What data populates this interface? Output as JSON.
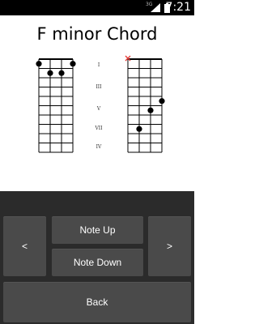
{
  "status_bar": {
    "network": "3G",
    "time": "7:21"
  },
  "chord": {
    "title": "F minor Chord"
  },
  "fret_markers": [
    "I",
    "III",
    "V",
    "VII",
    "IV"
  ],
  "left_diagram": {
    "dots": [
      {
        "string": 0,
        "fret": 1
      },
      {
        "string": 3,
        "fret": 1
      },
      {
        "string": 1,
        "fret": 2
      },
      {
        "string": 2,
        "fret": 2
      }
    ]
  },
  "right_diagram": {
    "muted": [
      {
        "string": 0
      }
    ],
    "dots": [
      {
        "string": 3,
        "fret": 5
      },
      {
        "string": 2,
        "fret": 6
      },
      {
        "string": 1,
        "fret": 8
      }
    ]
  },
  "controls": {
    "left_label": "<",
    "right_label": ">",
    "note_up_label": "Note Up",
    "note_down_label": "Note Down",
    "back_label": "Back"
  },
  "colors": {
    "controls_bg": "#2b2b2b",
    "button_bg": "#4a4a4a",
    "muted_mark": "#e53935"
  }
}
